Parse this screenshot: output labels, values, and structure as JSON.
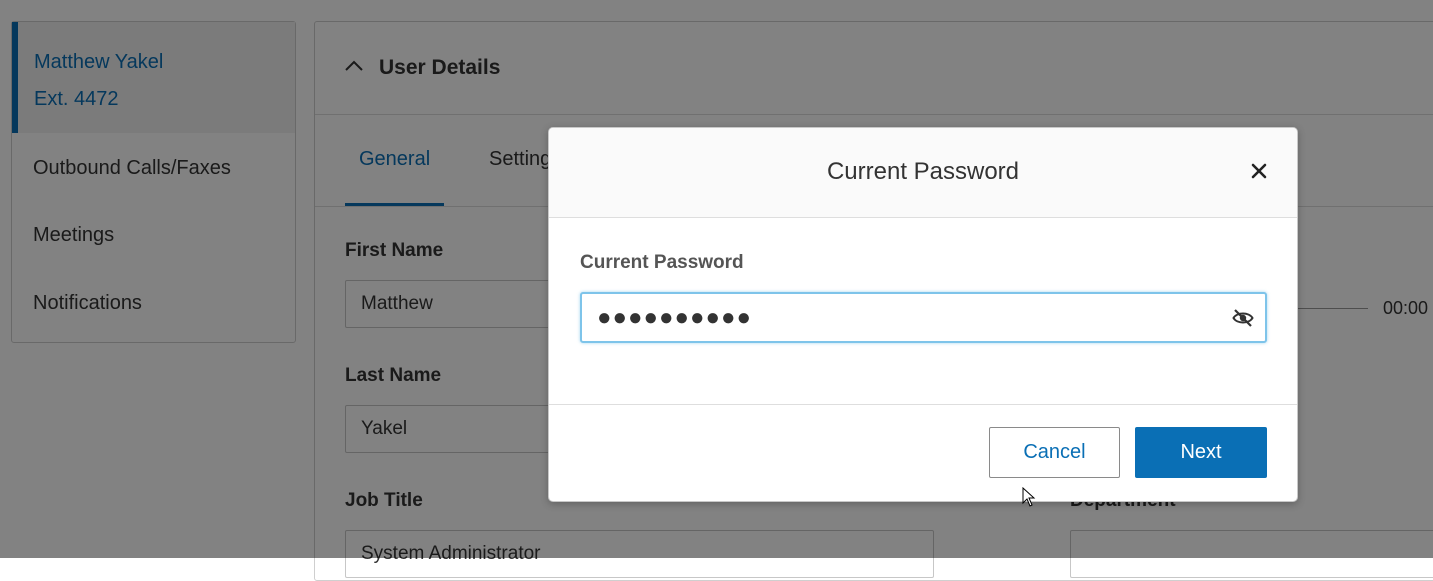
{
  "sidebar": {
    "user_name": "Matthew Yakel",
    "user_ext": "Ext. 4472",
    "items": [
      "Outbound Calls/Faxes",
      "Meetings",
      "Notifications"
    ]
  },
  "main": {
    "section_title": "User Details",
    "tabs": [
      "General",
      "Setting"
    ],
    "fields": {
      "first_name_label": "First Name",
      "first_name_value": "Matthew",
      "last_name_label": "Last Name",
      "last_name_value": "Yakel",
      "job_title_label": "Job Title",
      "job_title_value": "System Administrator",
      "department_label": "Department"
    },
    "right_time": "00:00"
  },
  "modal": {
    "title": "Current Password",
    "field_label": "Current Password",
    "password_masked": "●●●●●●●●●●",
    "cancel_label": "Cancel",
    "next_label": "Next"
  },
  "colors": {
    "accent": "#0a6fb5",
    "focus_border": "#7ec4ea"
  },
  "icons": [
    "chevron-up-icon",
    "close-icon",
    "eye-slash-icon"
  ]
}
